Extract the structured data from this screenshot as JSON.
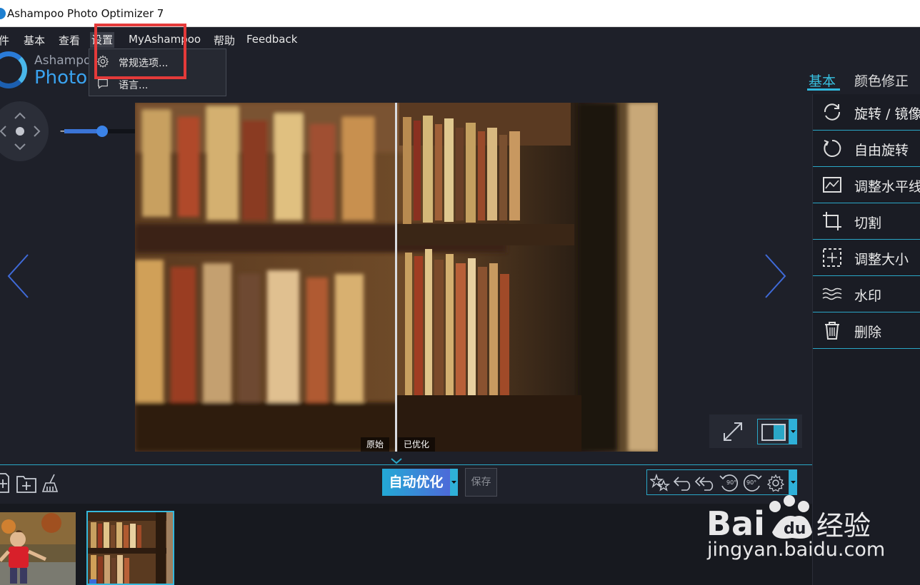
{
  "window": {
    "title": "Ashampoo Photo Optimizer 7"
  },
  "menu": {
    "items": [
      "件",
      "基本",
      "查看",
      "设置",
      "MyAshampoo",
      "帮助",
      "Feedback"
    ]
  },
  "logo": {
    "small": "Ashampoo",
    "big": "Photo"
  },
  "dropdown": {
    "items": [
      {
        "label": "常规选项...",
        "icon": "gear-icon"
      },
      {
        "label": "语言...",
        "icon": "speech-bubble-icon"
      }
    ]
  },
  "tabs": {
    "basic": "基本",
    "color": "颜色修正"
  },
  "tools": [
    {
      "label": "旋转 / 镜像",
      "icon": "rotate-mirror-icon"
    },
    {
      "label": "自由旋转",
      "icon": "free-rotate-icon"
    },
    {
      "label": "调整水平线",
      "icon": "horizon-icon"
    },
    {
      "label": "切割",
      "icon": "crop-icon"
    },
    {
      "label": "调整大小",
      "icon": "resize-icon"
    },
    {
      "label": "水印",
      "icon": "watermark-icon"
    },
    {
      "label": "删除",
      "icon": "trash-icon"
    }
  ],
  "zoom": {
    "minus": "−",
    "plus": "+",
    "level": 0.36
  },
  "compare": {
    "original": "原始",
    "optimized": "已优化"
  },
  "actions": {
    "auto_optimize": "自动优化",
    "save": "保存"
  },
  "edit_tools": {
    "rot_left_label": "90°",
    "rot_right_label": "90°"
  },
  "watermark": {
    "brand": "Bai",
    "brand2": "经验",
    "url": "jingyan.baidu.com"
  },
  "colors": {
    "accent": "#2aa7c7",
    "highlight": "#e43a3a"
  }
}
